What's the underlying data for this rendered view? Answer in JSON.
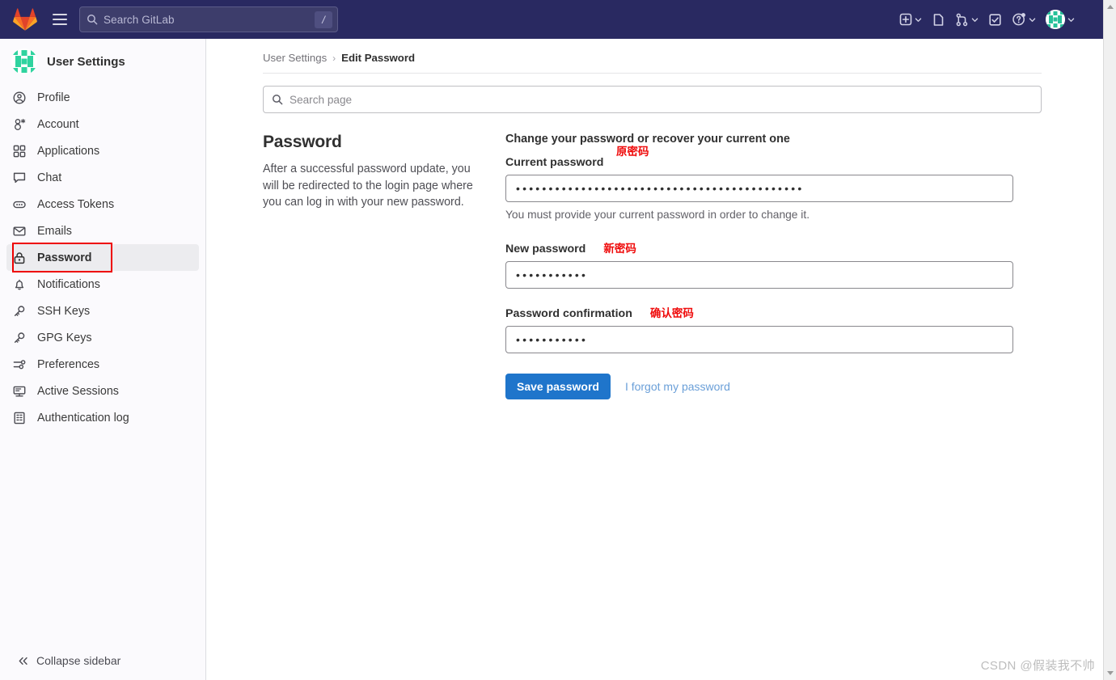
{
  "topnav": {
    "logo_icon": "gitlab-logo-icon",
    "menu_icon": "hamburger-menu-icon",
    "search": {
      "icon": "search-icon",
      "placeholder": "Search GitLab",
      "value": "",
      "shortcut_badge": "/"
    },
    "items": [
      {
        "icon": "create-new-icon",
        "label": "Create new",
        "has_caret": true
      },
      {
        "icon": "issues-icon",
        "label": "Issues",
        "has_caret": false
      },
      {
        "icon": "merge-requests-icon",
        "label": "Merge requests",
        "has_caret": true
      },
      {
        "icon": "todos-icon",
        "label": "To-Do List",
        "has_caret": false
      },
      {
        "icon": "help-icon",
        "label": "Help",
        "has_caret": true,
        "has_notification_dot": true
      },
      {
        "icon": "user-avatar-icon",
        "label": "User menu",
        "has_caret": true
      }
    ]
  },
  "sidebar": {
    "avatar_icon": "user-avatar-identicon",
    "title": "User Settings",
    "items": [
      {
        "label": "Profile",
        "icon": "profile-icon",
        "active": false
      },
      {
        "label": "Account",
        "icon": "account-icon",
        "active": false
      },
      {
        "label": "Applications",
        "icon": "applications-icon",
        "active": false
      },
      {
        "label": "Chat",
        "icon": "chat-icon",
        "active": false
      },
      {
        "label": "Access Tokens",
        "icon": "access-tokens-icon",
        "active": false
      },
      {
        "label": "Emails",
        "icon": "emails-icon",
        "active": false
      },
      {
        "label": "Password",
        "icon": "lock-icon",
        "active": true
      },
      {
        "label": "Notifications",
        "icon": "bell-icon",
        "active": false
      },
      {
        "label": "SSH Keys",
        "icon": "key-icon",
        "active": false
      },
      {
        "label": "GPG Keys",
        "icon": "key-icon",
        "active": false
      },
      {
        "label": "Preferences",
        "icon": "preferences-icon",
        "active": false
      },
      {
        "label": "Active Sessions",
        "icon": "monitor-icon",
        "active": false
      },
      {
        "label": "Authentication log",
        "icon": "log-icon",
        "active": false
      }
    ],
    "collapse_label": "Collapse sidebar",
    "collapse_icon": "double-chevron-left-icon"
  },
  "breadcrumb": {
    "parent": "User Settings",
    "separator": "›",
    "current": "Edit Password"
  },
  "page_search": {
    "icon": "search-icon",
    "placeholder": "Search page",
    "value": ""
  },
  "section": {
    "title": "Password",
    "description": "After a successful password update, you will be redirected to the login page where you can log in with your new password."
  },
  "form": {
    "lead": "Change your password or recover your current one",
    "current_password": {
      "label": "Current password",
      "annotation": "原密码",
      "value": "••••••••••••••••••••••••••••••••••••••••••••",
      "helper": "You must provide your current password in order to change it."
    },
    "new_password": {
      "label": "New password",
      "annotation": "新密码",
      "value": "•••••••••••"
    },
    "password_confirmation": {
      "label": "Password confirmation",
      "annotation": "确认密码",
      "value": "•••••••••••"
    },
    "save_button": "Save password",
    "forgot_link": "I forgot my password"
  },
  "watermark": "CSDN @假装我不帅",
  "colors": {
    "topnav_bg": "#292961",
    "sidebar_bg": "#fbfafd",
    "active_item_bg": "#ececef",
    "primary_button": "#1f75cb",
    "annotation_red": "#ef0b0b",
    "link_blue": "#6a9fd8"
  }
}
